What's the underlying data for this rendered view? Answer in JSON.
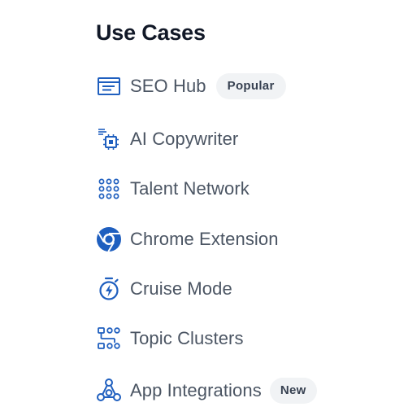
{
  "menu": {
    "title": "Use Cases",
    "accent_color": "#1f5fbf",
    "items": [
      {
        "label": "SEO Hub",
        "icon": "document-icon",
        "badge": "Popular"
      },
      {
        "label": "AI Copywriter",
        "icon": "chip-icon",
        "badge": ""
      },
      {
        "label": "Talent Network",
        "icon": "dot-grid-icon",
        "badge": ""
      },
      {
        "label": "Chrome Extension",
        "icon": "chrome-icon",
        "badge": ""
      },
      {
        "label": "Cruise Mode",
        "icon": "stopwatch-icon",
        "badge": ""
      },
      {
        "label": "Topic Clusters",
        "icon": "cluster-icon",
        "badge": ""
      },
      {
        "label": "App Integrations",
        "icon": "integrations-icon",
        "badge": "New"
      }
    ]
  }
}
